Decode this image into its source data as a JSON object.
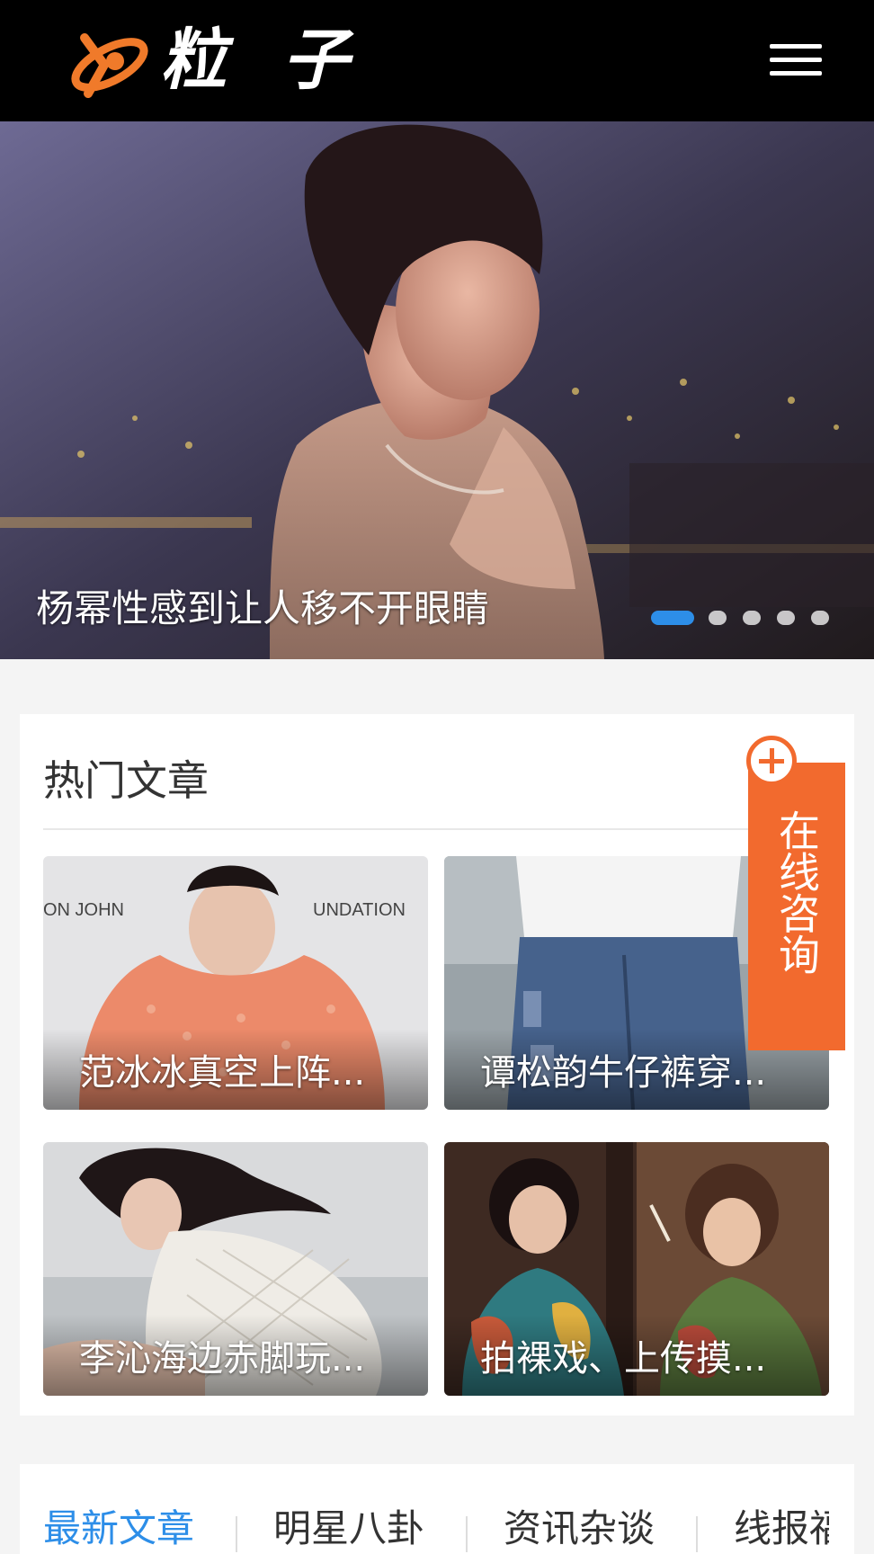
{
  "header": {
    "logo_icon": "orbit-x-logo-icon",
    "brand": "粒 子",
    "menu_icon": "hamburger-menu-icon"
  },
  "banner": {
    "caption": "杨幂性感到让人移不开眼睛",
    "slide_count": 5,
    "active_slide": 1
  },
  "hot_articles": {
    "title": "热门文章",
    "items": [
      {
        "title": "范冰冰真空上阵..."
      },
      {
        "title": "谭松韵牛仔裤穿..."
      },
      {
        "title": "李沁海边赤脚玩..."
      },
      {
        "title": "拍裸戏、上传摸..."
      }
    ]
  },
  "consult": {
    "label": "在线咨询",
    "icon": "plus-circle-icon"
  },
  "tabs": [
    {
      "label": "最新文章",
      "active": true
    },
    {
      "label": "明星八卦",
      "active": false
    },
    {
      "label": "资讯杂谈",
      "active": false
    },
    {
      "label": "线报福",
      "active": false
    }
  ],
  "colors": {
    "accent_blue": "#2d8ee8",
    "consult_orange": "#f26a2e",
    "header_bg": "#000000"
  }
}
